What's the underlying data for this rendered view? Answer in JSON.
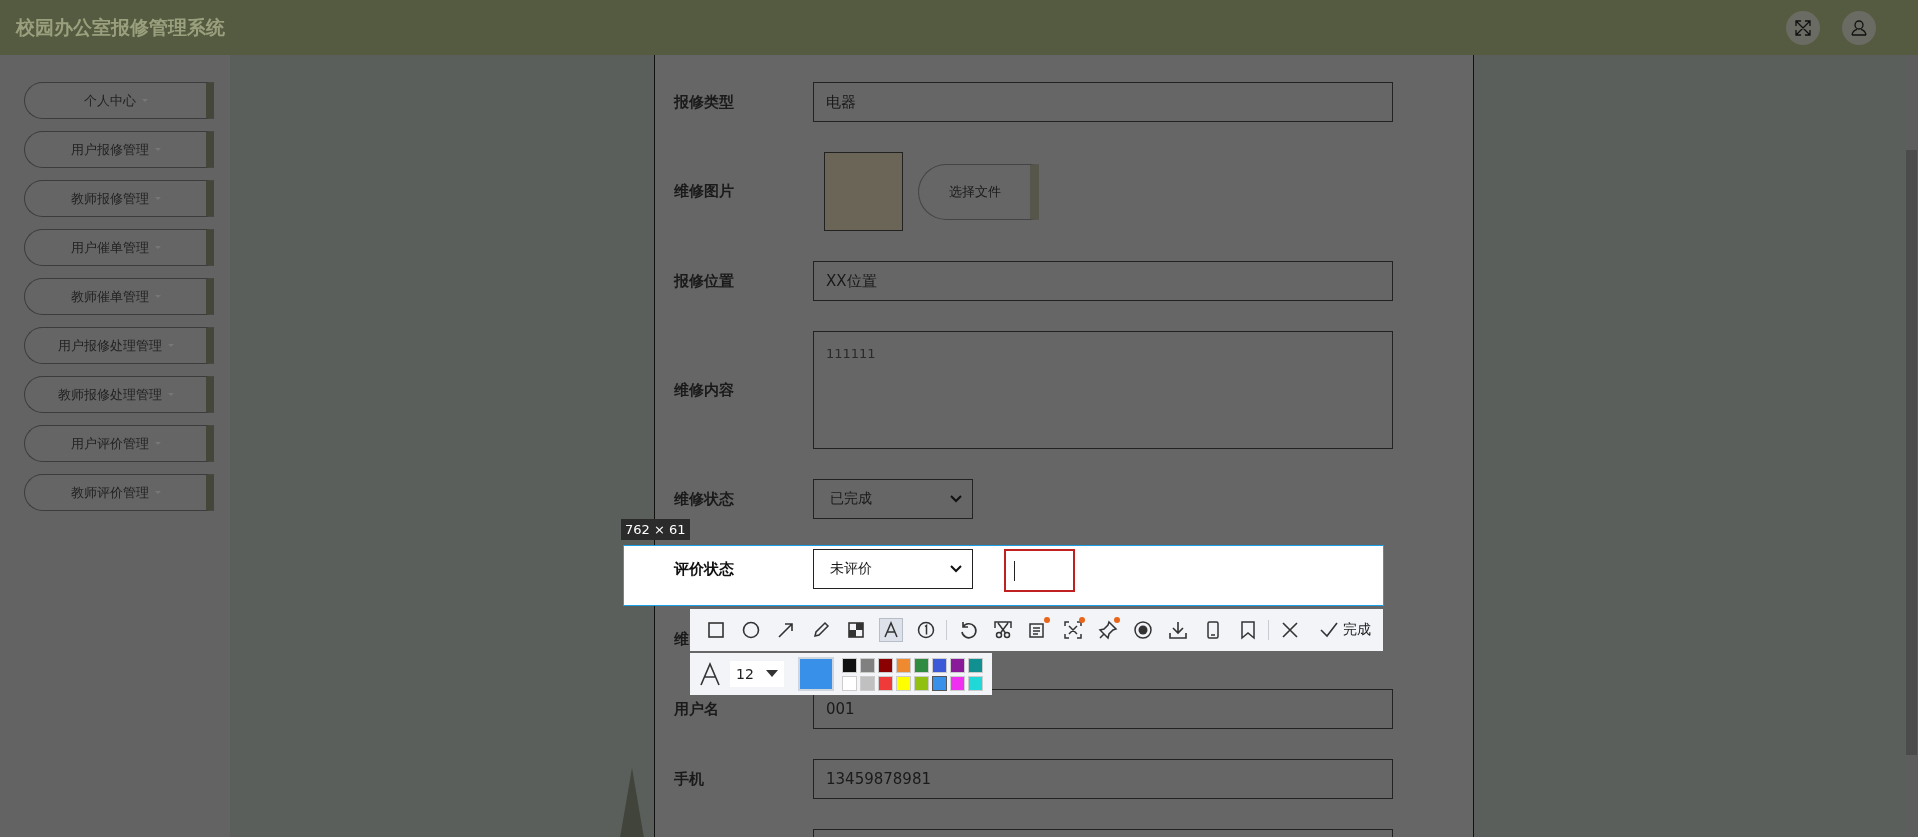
{
  "header": {
    "title": "校园办公室报修管理系统"
  },
  "sidebar": {
    "items": [
      {
        "label": "个人中心"
      },
      {
        "label": "用户报修管理"
      },
      {
        "label": "教师报修管理"
      },
      {
        "label": "用户催单管理"
      },
      {
        "label": "教师催单管理"
      },
      {
        "label": "用户报修处理管理"
      },
      {
        "label": "教师报修处理管理"
      },
      {
        "label": "用户评价管理"
      },
      {
        "label": "教师评价管理"
      }
    ]
  },
  "form": {
    "fields": [
      {
        "label": "报修类型",
        "kind": "text",
        "value": "电器"
      },
      {
        "label": "维修图片",
        "kind": "image",
        "button": "选择文件"
      },
      {
        "label": "报修位置",
        "kind": "text",
        "value": "XX位置"
      },
      {
        "label": "维修内容",
        "kind": "textarea",
        "value": "111111"
      },
      {
        "label": "维修状态",
        "kind": "select",
        "value": "已完成"
      },
      {
        "label": "评价状态",
        "kind": "select",
        "value": "未评价"
      },
      {
        "label": "维",
        "kind": "covered"
      },
      {
        "label": "用户名",
        "kind": "text",
        "value": "001"
      },
      {
        "label": "手机",
        "kind": "text",
        "value": "13459878981"
      },
      {
        "kind": "text"
      }
    ]
  },
  "capture": {
    "size_label": "762 × 61",
    "tools": [
      {
        "selected": false,
        "badge": false
      },
      {
        "selected": false,
        "badge": false
      },
      {
        "selected": false,
        "badge": false
      },
      {
        "selected": false,
        "badge": false
      },
      {
        "selected": false,
        "badge": false
      },
      {
        "selected": true,
        "badge": false
      },
      {
        "selected": false,
        "badge": false
      },
      {
        "selected": false,
        "badge": false
      },
      {
        "selected": false,
        "badge": false
      },
      {
        "selected": false,
        "badge": true
      },
      {
        "selected": false,
        "badge": true
      },
      {
        "selected": false,
        "badge": true
      },
      {
        "selected": false,
        "badge": false
      },
      {
        "selected": false,
        "badge": false
      },
      {
        "selected": false,
        "badge": false
      },
      {
        "selected": false,
        "badge": false
      }
    ],
    "done_label": "完成",
    "font_size": "12",
    "palette": [
      {
        "color": "#111111",
        "selected": false
      },
      {
        "color": "#808080",
        "selected": false
      },
      {
        "color": "#8b0000",
        "selected": false
      },
      {
        "color": "#f08a30",
        "selected": false
      },
      {
        "color": "#2e8b40",
        "selected": false
      },
      {
        "color": "#3c5ad8",
        "selected": false
      },
      {
        "color": "#8a1a9a",
        "selected": false
      },
      {
        "color": "#109090",
        "selected": false
      },
      {
        "color": "#ffffff",
        "selected": false
      },
      {
        "color": "#c0c0c0",
        "selected": false
      },
      {
        "color": "#f03a3a",
        "selected": false
      },
      {
        "color": "#ffff00",
        "selected": false
      },
      {
        "color": "#90c010",
        "selected": false
      },
      {
        "color": "#3890e8",
        "selected": true
      },
      {
        "color": "#f030f0",
        "selected": false
      },
      {
        "color": "#20d8d8",
        "selected": false
      }
    ]
  }
}
